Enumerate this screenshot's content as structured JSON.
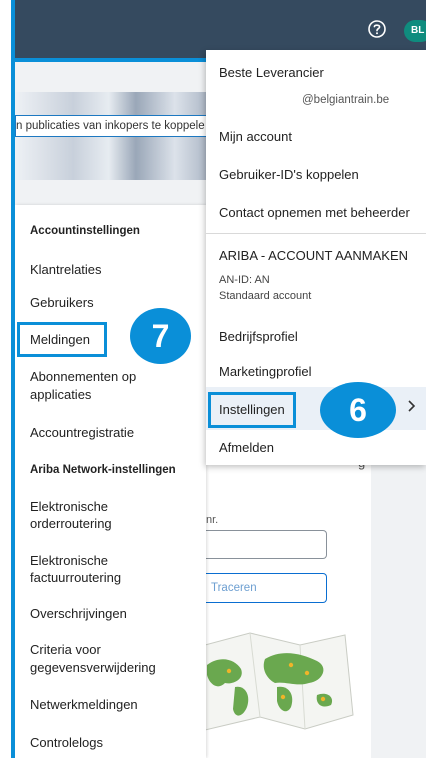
{
  "topbar": {
    "help_icon": "question-circle-icon",
    "avatar_initials": "BL",
    "background": "#354a5f"
  },
  "banner": {
    "text": "n publicaties van inkopers te koppele"
  },
  "left_menu": {
    "header_account": "Accountinstellingen",
    "items_account": [
      "Klantrelaties",
      "Gebruikers",
      "Meldingen",
      "Abonnementen op applicaties",
      "Accountregistratie"
    ],
    "header_network": "Ariba Network-instellingen",
    "items_network": [
      "Elektronische orderroutering",
      "Elektronische factuurroutering",
      "Overschrijvingen",
      "Criteria voor gegevensverwijdering",
      "Netwerkmeldingen",
      "Controlelogs"
    ]
  },
  "left_menu_lines": {
    "abonnementen_1": "Abonnementen op",
    "abonnementen_2": "applicaties",
    "order_1": "Elektronische",
    "order_2": "orderroutering",
    "factuur_1": "Elektronische",
    "factuur_2": "factuurroutering",
    "criteria_1": "Criteria voor",
    "criteria_2": "gegevensverwijdering"
  },
  "dropdown": {
    "user_name": "Beste Leverancier",
    "user_email": "@belgiantrain.be",
    "my_account": "Mijn account",
    "link_ids": "Gebruiker-ID's koppelen",
    "contact_admin": "Contact opnemen met beheerder",
    "create_account": "ARIBA - ACCOUNT AANMAKEN",
    "an_id": "AN-ID: AN",
    "account_type": "Standaard account",
    "company_profile": "Bedrijfsprofiel",
    "marketing_profile": "Marketingprofiel",
    "settings": "Instellingen",
    "logout": "Afmelden"
  },
  "background_panel": {
    "label": "nr.",
    "button": "Traceren",
    "heading_fragment": "g"
  },
  "steps": {
    "step_settings": "6",
    "step_notifications": "7"
  },
  "colors": {
    "highlight": "#0a8fd8",
    "selected_row": "#eaf0f7"
  }
}
